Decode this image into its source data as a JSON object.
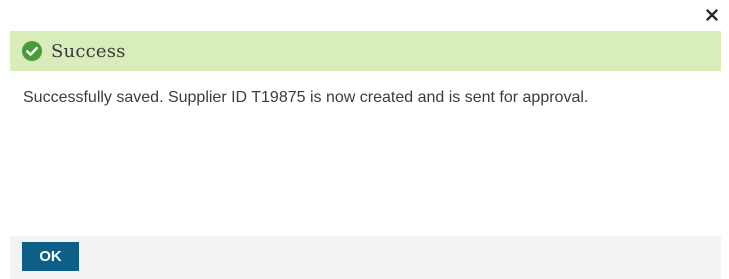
{
  "dialog": {
    "close_icon": "close-icon",
    "header": {
      "icon": "check-circle-icon",
      "title": "Success",
      "background_color": "#d8edb9",
      "icon_color": "#4a9a3a"
    },
    "message": "Successfully saved. Supplier ID T19875 is now created and is sent for approval.",
    "footer": {
      "ok_label": "OK",
      "button_color": "#0d5f87"
    }
  }
}
